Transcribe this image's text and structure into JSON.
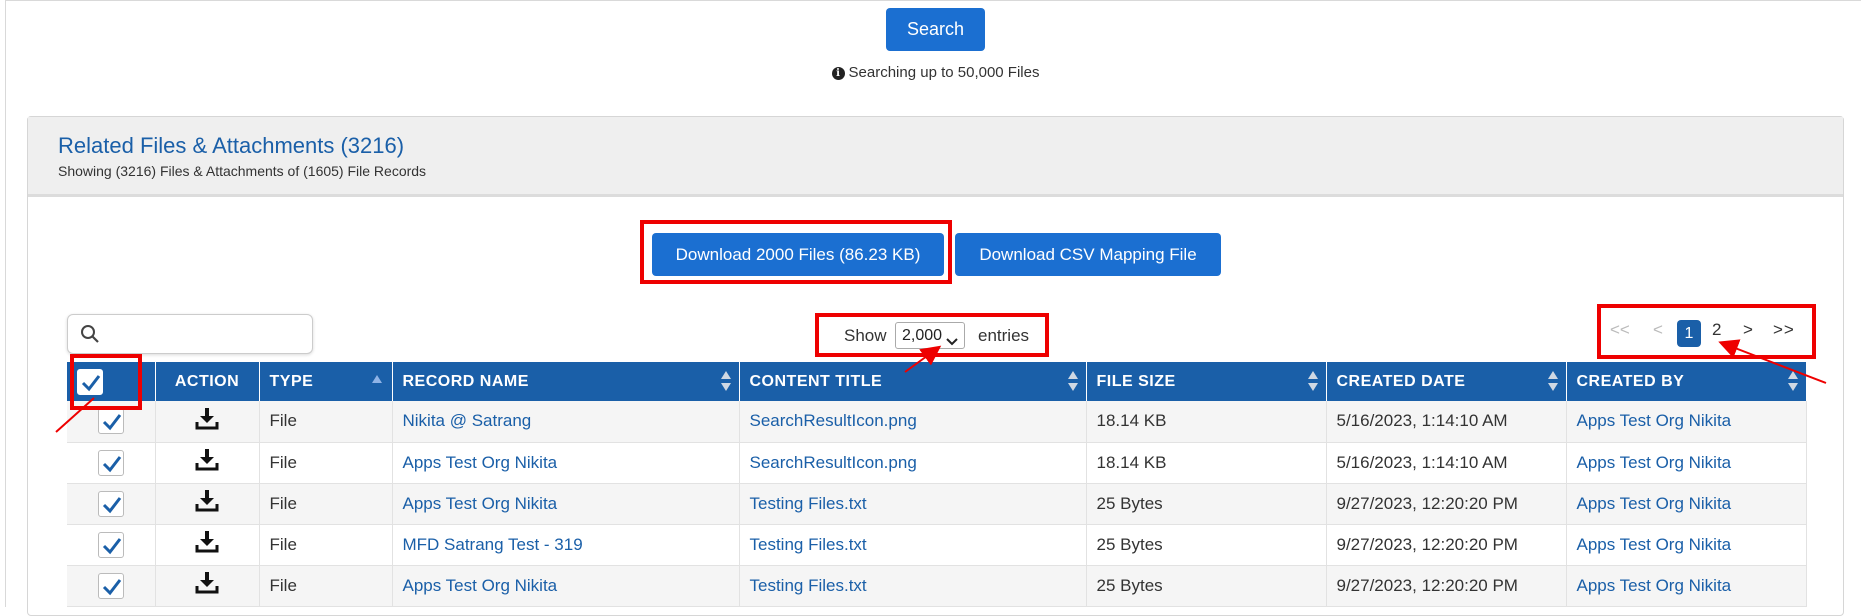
{
  "search": {
    "button_label": "Search",
    "note": "Searching up to 50,000 Files"
  },
  "panel": {
    "title": "Related Files & Attachments (3216)",
    "subtitle": "Showing (3216) Files & Attachments of (1605) File Records"
  },
  "actions": {
    "download_label": "Download 2000 Files (86.23 KB)",
    "csv_label": "Download CSV Mapping File"
  },
  "table_controls": {
    "search_placeholder": "",
    "show_label": "Show",
    "entries_value": "2,000",
    "entries_label": "entries"
  },
  "pagination": {
    "first": "<<",
    "prev": "<",
    "current": "1",
    "page2": "2",
    "next": ">",
    "last": ">>"
  },
  "table": {
    "headers": {
      "action": "ACTION",
      "type": "TYPE",
      "record_name": "RECORD NAME",
      "content_title": "CONTENT TITLE",
      "file_size": "FILE SIZE",
      "created_date": "CREATED DATE",
      "created_by": "CREATED BY"
    },
    "rows": [
      {
        "type": "File",
        "record_name": "Nikita @ Satrang",
        "content_title": "SearchResultIcon.png",
        "file_size": "18.14 KB",
        "created_date": "5/16/2023, 1:14:10 AM",
        "created_by": "Apps Test Org Nikita"
      },
      {
        "type": "File",
        "record_name": "Apps Test Org Nikita",
        "content_title": "SearchResultIcon.png",
        "file_size": "18.14 KB",
        "created_date": "5/16/2023, 1:14:10 AM",
        "created_by": "Apps Test Org Nikita"
      },
      {
        "type": "File",
        "record_name": "Apps Test Org Nikita",
        "content_title": "Testing Files.txt",
        "file_size": "25 Bytes",
        "created_date": "9/27/2023, 12:20:20 PM",
        "created_by": "Apps Test Org Nikita"
      },
      {
        "type": "File",
        "record_name": "MFD Satrang Test - 319",
        "content_title": "Testing Files.txt",
        "file_size": "25 Bytes",
        "created_date": "9/27/2023, 12:20:20 PM",
        "created_by": "Apps Test Org Nikita"
      },
      {
        "type": "File",
        "record_name": "Apps Test Org Nikita",
        "content_title": "Testing Files.txt",
        "file_size": "25 Bytes",
        "created_date": "9/27/2023, 12:20:20 PM",
        "created_by": "Apps Test Org Nikita"
      }
    ]
  },
  "colors": {
    "primary": "#1b6fd1",
    "header_blue": "#1a5fa8",
    "annotation_red": "#ee0000"
  }
}
